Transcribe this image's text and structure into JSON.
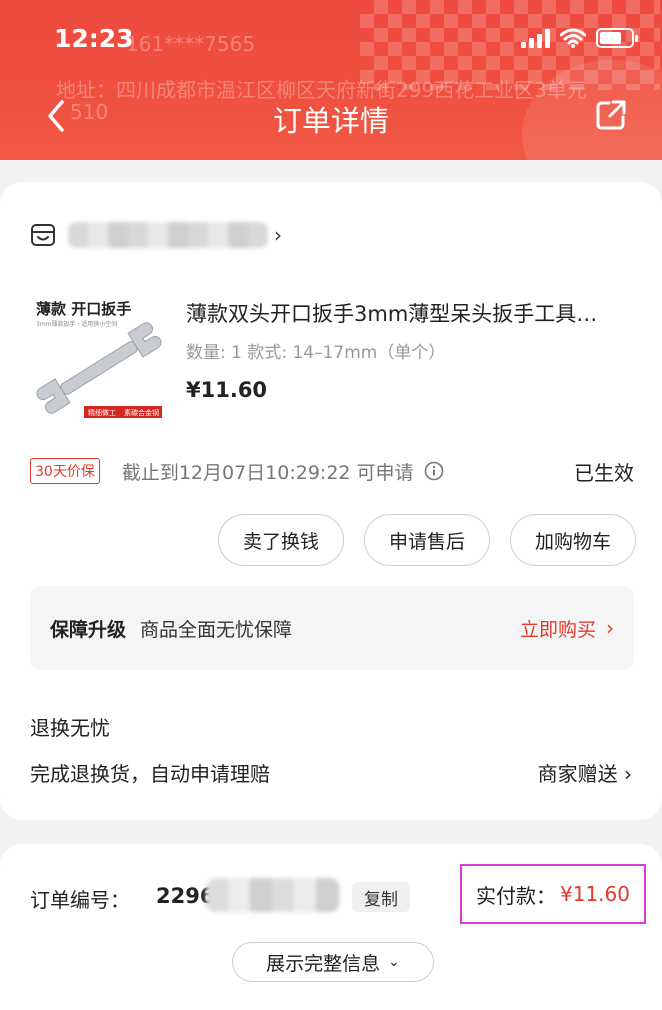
{
  "status_bar": {
    "time": "12:23"
  },
  "header": {
    "title": "订单详情",
    "ghost_phone": "161****7565",
    "ghost_address": "地址：四川成都市温江区柳区天府新街299西花工业区3单元",
    "ghost_extra": "510"
  },
  "store": {
    "name_hidden": true
  },
  "product": {
    "image_title": "薄款 开口扳手",
    "image_subtitle": "3mm薄款扳手 · 适用狭小空间",
    "image_badge_left": "精细做工",
    "image_badge_right": "素碳合金钢",
    "title": "薄款双头开口扳手3mm薄型呆头扳手工具…",
    "spec": "数量: 1   款式: 14–17mm（单个）",
    "price": "¥11.60"
  },
  "guarantee": {
    "tag": "30天价保",
    "deadline": "截止到12月07日10:29:22 可申请",
    "state": "已生效"
  },
  "actions": {
    "sell": "卖了换钱",
    "after_sale": "申请售后",
    "add_cart": "加购物车"
  },
  "upgrade": {
    "title": "保障升级",
    "desc": "商品全面无忧保障",
    "buy": "立即购买"
  },
  "worry": {
    "title": "退换无忧",
    "desc": "完成退换货，自动申请理赔",
    "gift": "商家赠送"
  },
  "order": {
    "label": "订单编号：",
    "number_prefix": "2296",
    "copy": "复制",
    "paid_label": "实付款：",
    "paid_value": "¥11.60",
    "expand": "展示完整信息"
  },
  "colors": {
    "header_red": "#ee4a40",
    "accent_red": "#e2392d",
    "highlight_box": "#d53fd5"
  }
}
